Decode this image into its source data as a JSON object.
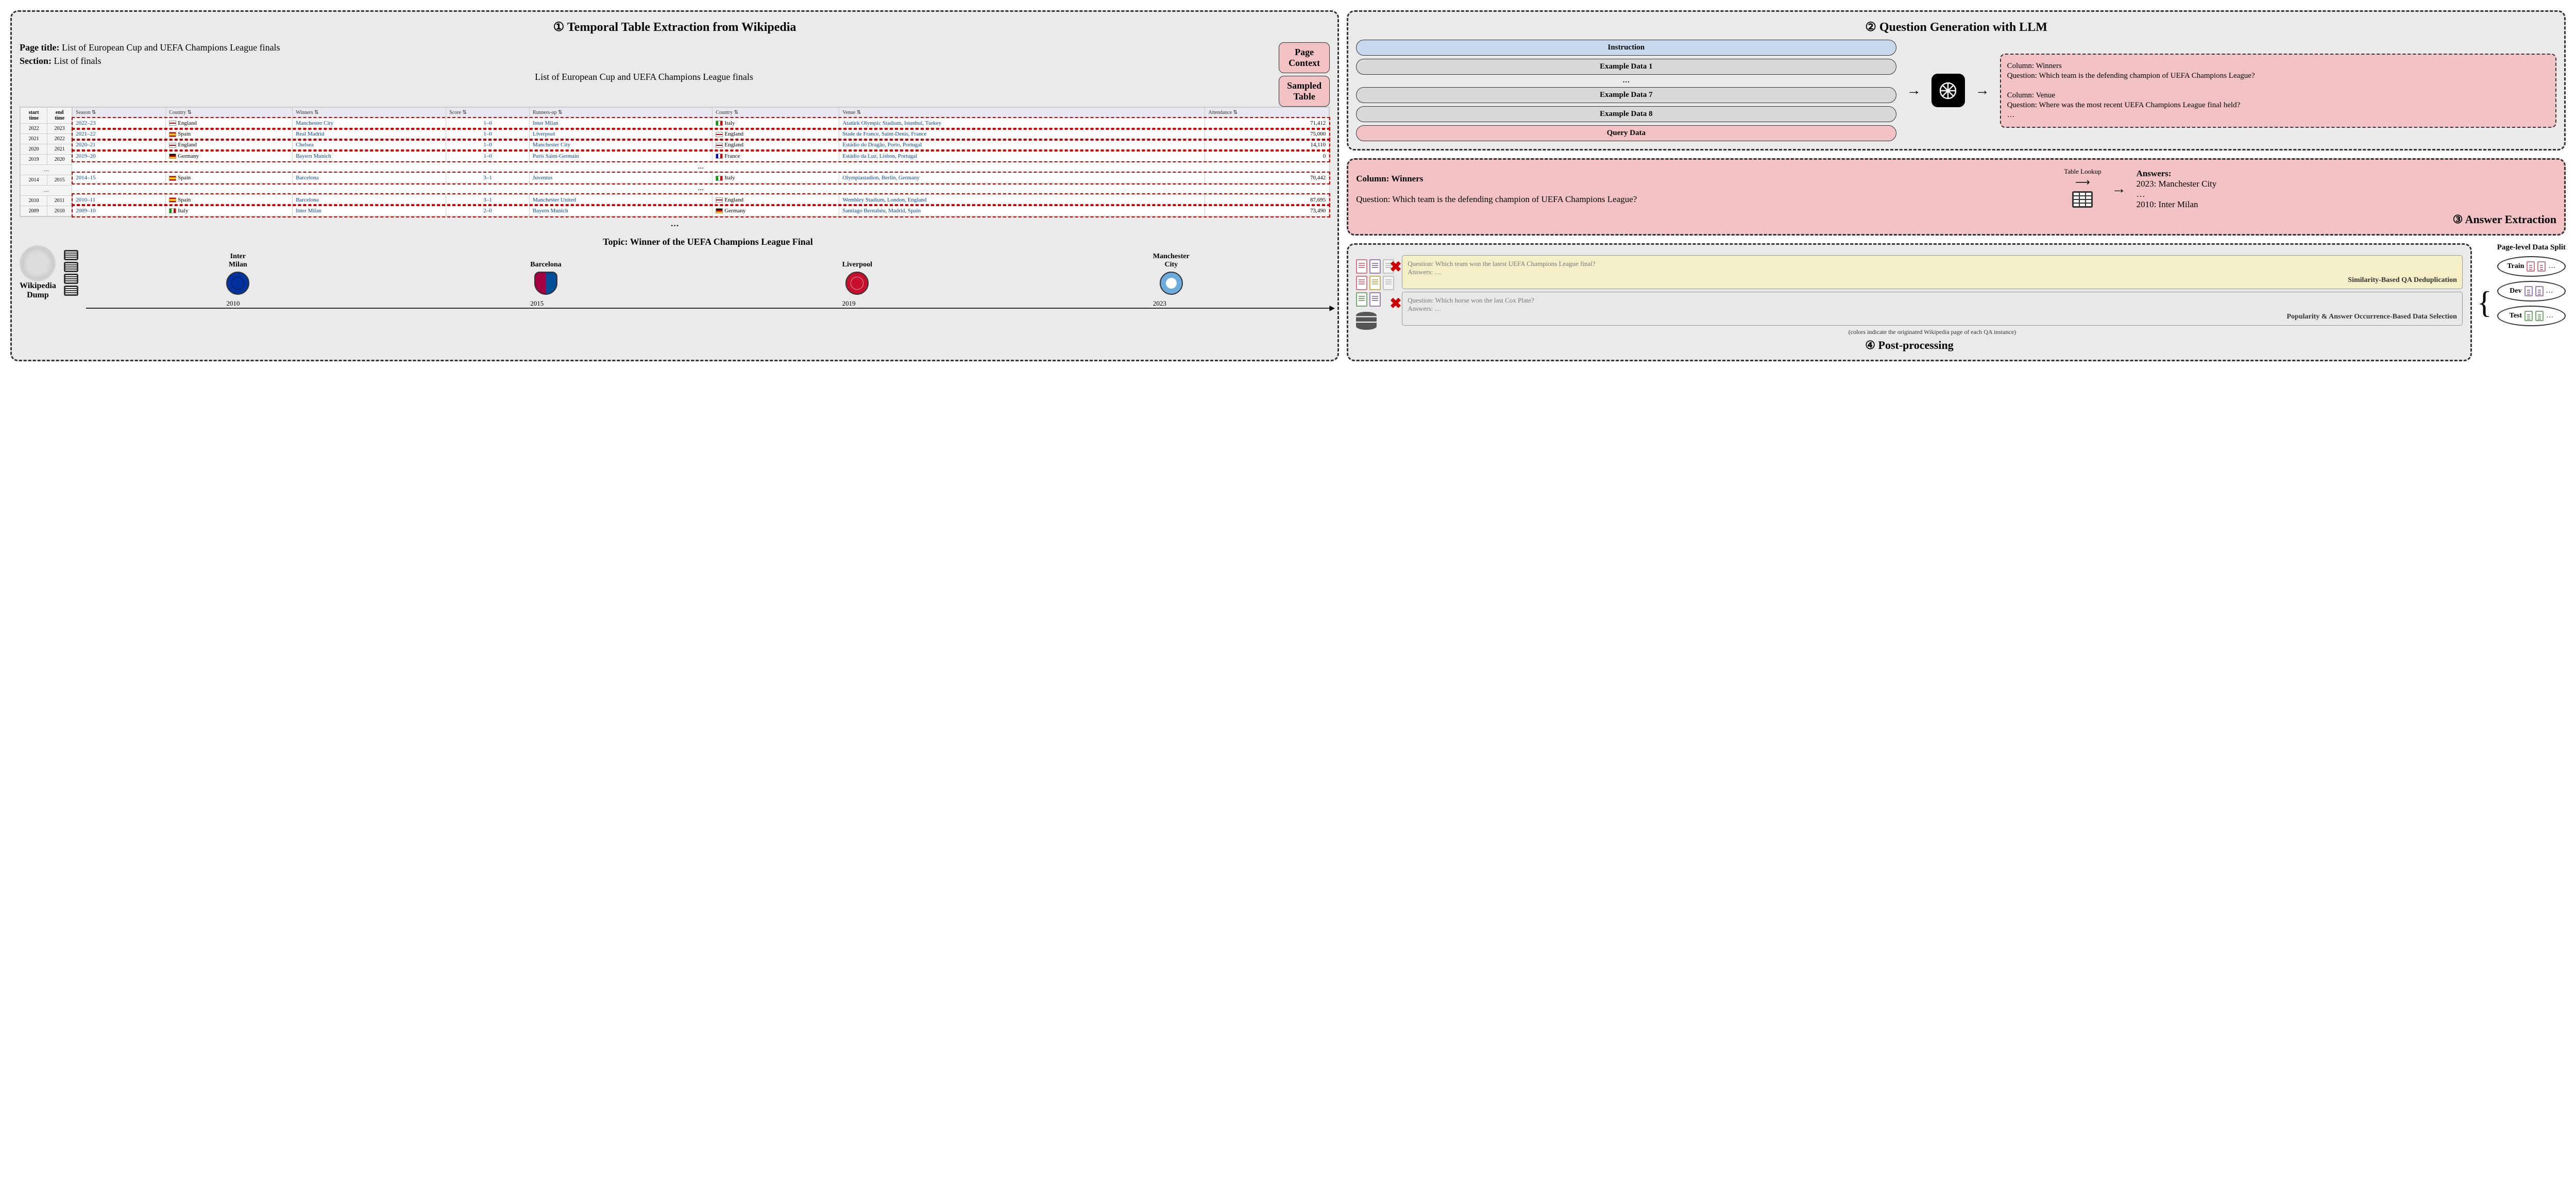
{
  "panel1": {
    "title": "① Temporal Table Extraction from Wikipedia",
    "page_title_label": "Page title:",
    "page_title": "List of European Cup and UEFA Champions League finals",
    "section_label": "Section:",
    "section": "List of finals",
    "context_box1": "Page\nContext",
    "context_box2": "Sampled\nTable",
    "table_caption": "List of European Cup and UEFA Champions League finals",
    "time_headers": [
      "start time",
      "end time"
    ],
    "headers": [
      "Season",
      "Country",
      "Winners",
      "Score",
      "Runners-up",
      "Country",
      "Venue",
      "Attendance"
    ],
    "rows": [
      {
        "start": "2022",
        "end": "2023",
        "season": "2022–23",
        "c1_flag": "eng",
        "c1": "England",
        "win": "Manchester City",
        "score": "1–0",
        "ru": "Inter Milan",
        "c2_flag": "ita",
        "c2": "Italy",
        "venue": "Atatürk Olympic Stadium, Istanbul, Turkey",
        "att": "71,412"
      },
      {
        "start": "2021",
        "end": "2022",
        "season": "2021–22",
        "c1_flag": "esp",
        "c1": "Spain",
        "win": "Real Madrid",
        "score": "1–0",
        "ru": "Liverpool",
        "c2_flag": "eng",
        "c2": "England",
        "venue": "Stade de France, Saint-Denis, France",
        "att": "75,000"
      },
      {
        "start": "2020",
        "end": "2021",
        "season": "2020–21",
        "c1_flag": "eng",
        "c1": "England",
        "win": "Chelsea",
        "score": "1–0",
        "ru": "Manchester City",
        "c2_flag": "eng",
        "c2": "England",
        "venue": "Estádio do Dragão, Porto, Portugal",
        "att": "14,110"
      },
      {
        "start": "2019",
        "end": "2020",
        "season": "2019–20",
        "c1_flag": "ger",
        "c1": "Germany",
        "win": "Bayern Munich",
        "score": "1–0",
        "ru": "Paris Saint-Germain",
        "c2_flag": "fra",
        "c2": "France",
        "venue": "Estádio da Luz, Lisbon, Portugal",
        "att": "0"
      },
      {
        "start": "2014",
        "end": "2015",
        "season": "2014–15",
        "c1_flag": "esp",
        "c1": "Spain",
        "win": "Barcelona",
        "score": "3–1",
        "ru": "Juventus",
        "c2_flag": "ita",
        "c2": "Italy",
        "venue": "Olympiastadion, Berlin, Germany",
        "att": "70,442"
      },
      {
        "start": "2010",
        "end": "2011",
        "season": "2010–11",
        "c1_flag": "esp",
        "c1": "Spain",
        "win": "Barcelona",
        "score": "3–1",
        "ru": "Manchester United",
        "c2_flag": "eng",
        "c2": "England",
        "venue": "Wembley Stadium, London, England",
        "att": "87,695"
      },
      {
        "start": "2009",
        "end": "2010",
        "season": "2009–10",
        "c1_flag": "ita",
        "c1": "Italy",
        "win": "Inter Milan",
        "score": "2–0",
        "ru": "Bayern Munich",
        "c2_flag": "ger",
        "c2": "Germany",
        "venue": "Santiago Bernabéu, Madrid, Spain",
        "att": "73,490"
      }
    ],
    "wiki_dump_label": "Wikipedia\nDump",
    "topic_label": "Topic: Winner of the UEFA Champions League Final",
    "timeline": [
      {
        "team": "Inter\nMilan",
        "year": "2010",
        "badge": "inter"
      },
      {
        "team": "Barcelona",
        "year": "2015",
        "badge": "barca"
      },
      {
        "team": "Liverpool",
        "year": "2019",
        "badge": "liv"
      },
      {
        "team": "Manchester\nCity",
        "year": "2023",
        "badge": "city"
      }
    ]
  },
  "panel2": {
    "title": "② Question Generation with LLM",
    "instruction": "Instruction",
    "example1": "Example Data 1",
    "example7": "Example Data 7",
    "example8": "Example Data 8",
    "query": "Query Data",
    "output_col1": "Column: Winners",
    "output_q1": "Question: Which team is the defending champion of UEFA Champions League?",
    "output_col2": "Column: Venue",
    "output_q2": "Question: Where was the most recent UEFA Champions League final held?",
    "output_more": "…"
  },
  "panel3": {
    "col_label": "Column: Winners",
    "lookup": "Table Lookup",
    "question": "Question: Which team is the defending champion of UEFA Champions League?",
    "answers_label": "Answers:",
    "answer1": "2023: Manchester City",
    "answer_more": "…",
    "answer2": "2010: Inter Milan",
    "title": "③ Answer Extraction"
  },
  "panel4": {
    "filter1_q": "Question: Which team won the latest UEFA Champions League final?",
    "filter1_a": "Answers: …",
    "filter1_label": "Similarity-Based QA Deduplication",
    "filter2_q": "Question: Which horse won the last Cox Plate?",
    "filter2_a": "Answers: …",
    "filter2_label": "Popularity & Answer Occurrence-Based Data Selection",
    "footnote": "(colors indicate the originated Wikipedia page of each QA instance)",
    "title": "④ Post-processing",
    "split_label": "Page-level Data Split",
    "splits": [
      "Train",
      "Dev",
      "Test"
    ]
  }
}
